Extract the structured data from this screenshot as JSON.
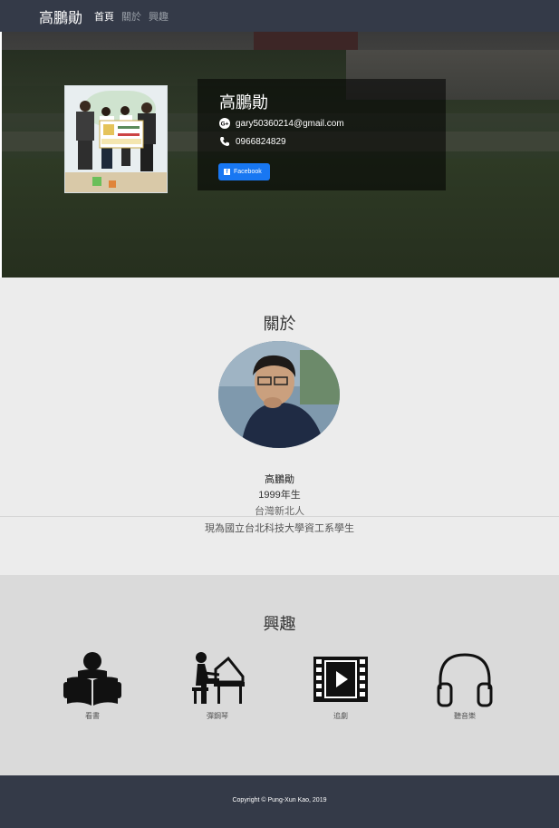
{
  "navbar": {
    "brand": "高鵬勛",
    "links": [
      "首頁",
      "關於",
      "興趣"
    ]
  },
  "hero": {
    "name": "高鵬勛",
    "email": "gary50360214@gmail.com",
    "phone": "0966824829",
    "facebook_label": "Facebook"
  },
  "about": {
    "title": "關於",
    "name": "高鵬勛",
    "birth_year": "1999年生",
    "hometown": "台灣新北人",
    "school": "現為國立台北科技大學資工系學生"
  },
  "hobbies": {
    "title": "興趣",
    "items": [
      {
        "label": "看書",
        "icon": "reading-icon"
      },
      {
        "label": "彈鋼琴",
        "icon": "piano-icon"
      },
      {
        "label": "追劇",
        "icon": "film-icon"
      },
      {
        "label": "聽音樂",
        "icon": "headphones-icon"
      }
    ]
  },
  "footer": {
    "copyright": "Copyright © Pung-Xun Kao, 2019"
  },
  "colors": {
    "navbar": "#343a48",
    "facebook": "#1877f2",
    "about_bg": "#ececec",
    "hobbies_bg": "#dadada"
  }
}
